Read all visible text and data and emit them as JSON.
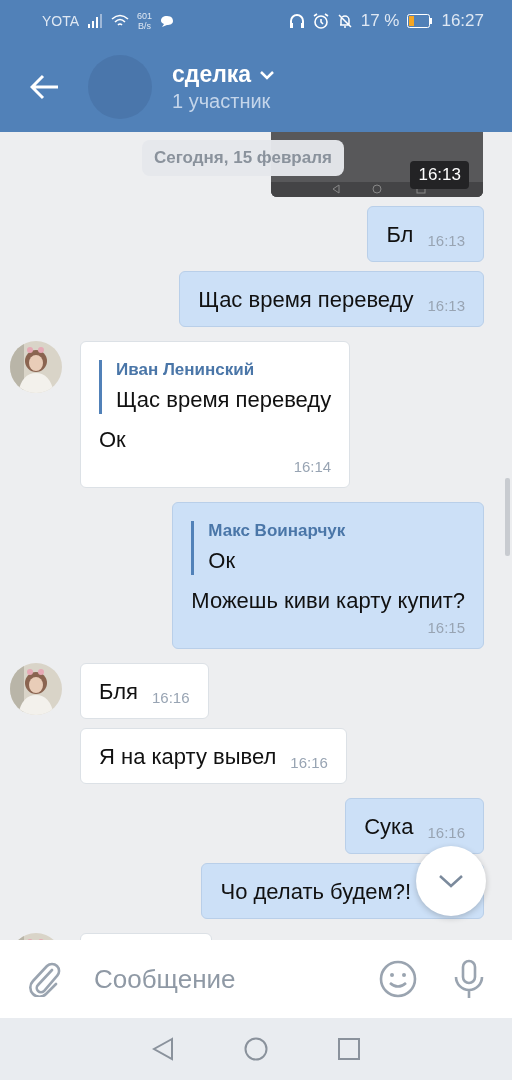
{
  "status_bar": {
    "carrier": "YOTA",
    "speed_value": "601",
    "speed_unit": "B/s",
    "battery": "17 %",
    "time": "16:27"
  },
  "header": {
    "title": "сделка",
    "subtitle": "1 участник"
  },
  "date_divider": "Сегодня, 15 февраля",
  "messages": [
    {
      "outgoing": true,
      "time": "16:13"
    },
    {
      "kind": "text",
      "outgoing": true,
      "text": "Бл",
      "time": "16:13"
    },
    {
      "kind": "text",
      "outgoing": true,
      "text": "Щас время переведу",
      "time": "16:13"
    },
    {
      "kind": "reply",
      "outgoing": false,
      "avatar": true,
      "quote_author": "Иван Ленинский",
      "quote_text": "Щас время переведу",
      "text": "Ок",
      "time": "16:14"
    },
    {
      "kind": "reply",
      "outgoing": true,
      "quote_author": "Макс Воинарчук",
      "quote_text": "Ок",
      "text": "Можешь киви карту купит?",
      "time": "16:15"
    },
    {
      "kind": "text",
      "outgoing": false,
      "avatar": true,
      "text": "Бля",
      "time": "16:16"
    },
    {
      "kind": "text",
      "outgoing": false,
      "avatar": false,
      "text": "Я на карту вывел",
      "time": "16:16"
    },
    {
      "kind": "text",
      "outgoing": true,
      "text": "Сука",
      "time": "16:16"
    },
    {
      "kind": "text",
      "outgoing": true,
      "text": "Чо делать будем?!"
    },
    {
      "kind": "partial",
      "outgoing": false,
      "avatar": true
    }
  ],
  "composer": {
    "placeholder": "Сообщение"
  }
}
